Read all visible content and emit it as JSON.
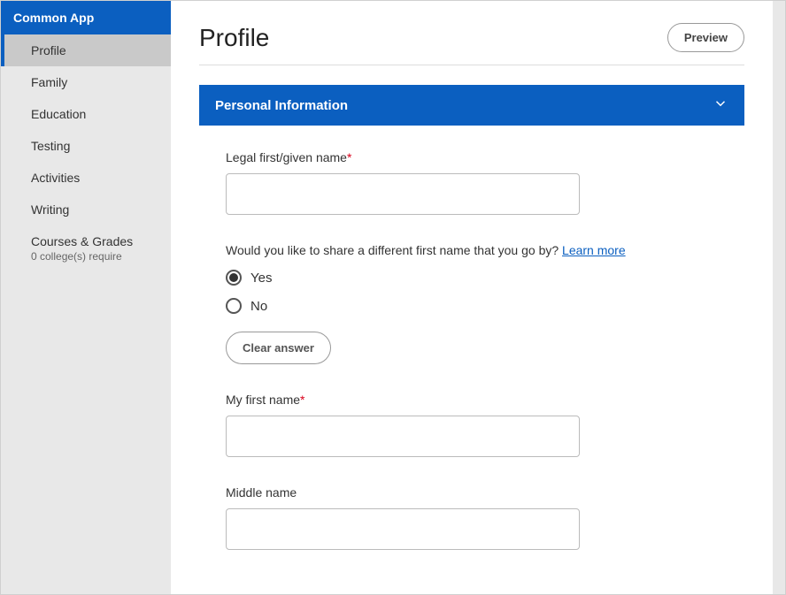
{
  "sidebar": {
    "header": "Common App",
    "items": [
      {
        "label": "Profile",
        "active": true
      },
      {
        "label": "Family"
      },
      {
        "label": "Education"
      },
      {
        "label": "Testing"
      },
      {
        "label": "Activities"
      },
      {
        "label": "Writing"
      },
      {
        "label": "Courses & Grades",
        "sub": "0 college(s) require"
      }
    ]
  },
  "header": {
    "title": "Profile",
    "preview_label": "Preview"
  },
  "section": {
    "title": "Personal Information"
  },
  "fields": {
    "legal_first_name": {
      "label": "Legal first/given name",
      "value": ""
    },
    "share_different": {
      "question": "Would you like to share a different first name that you go by? ",
      "learn_more": "Learn more",
      "options": {
        "yes": "Yes",
        "no": "No"
      },
      "selected": "yes",
      "clear_label": "Clear answer"
    },
    "my_first_name": {
      "label": "My first name",
      "value": ""
    },
    "middle_name": {
      "label": "Middle name",
      "value": ""
    }
  }
}
